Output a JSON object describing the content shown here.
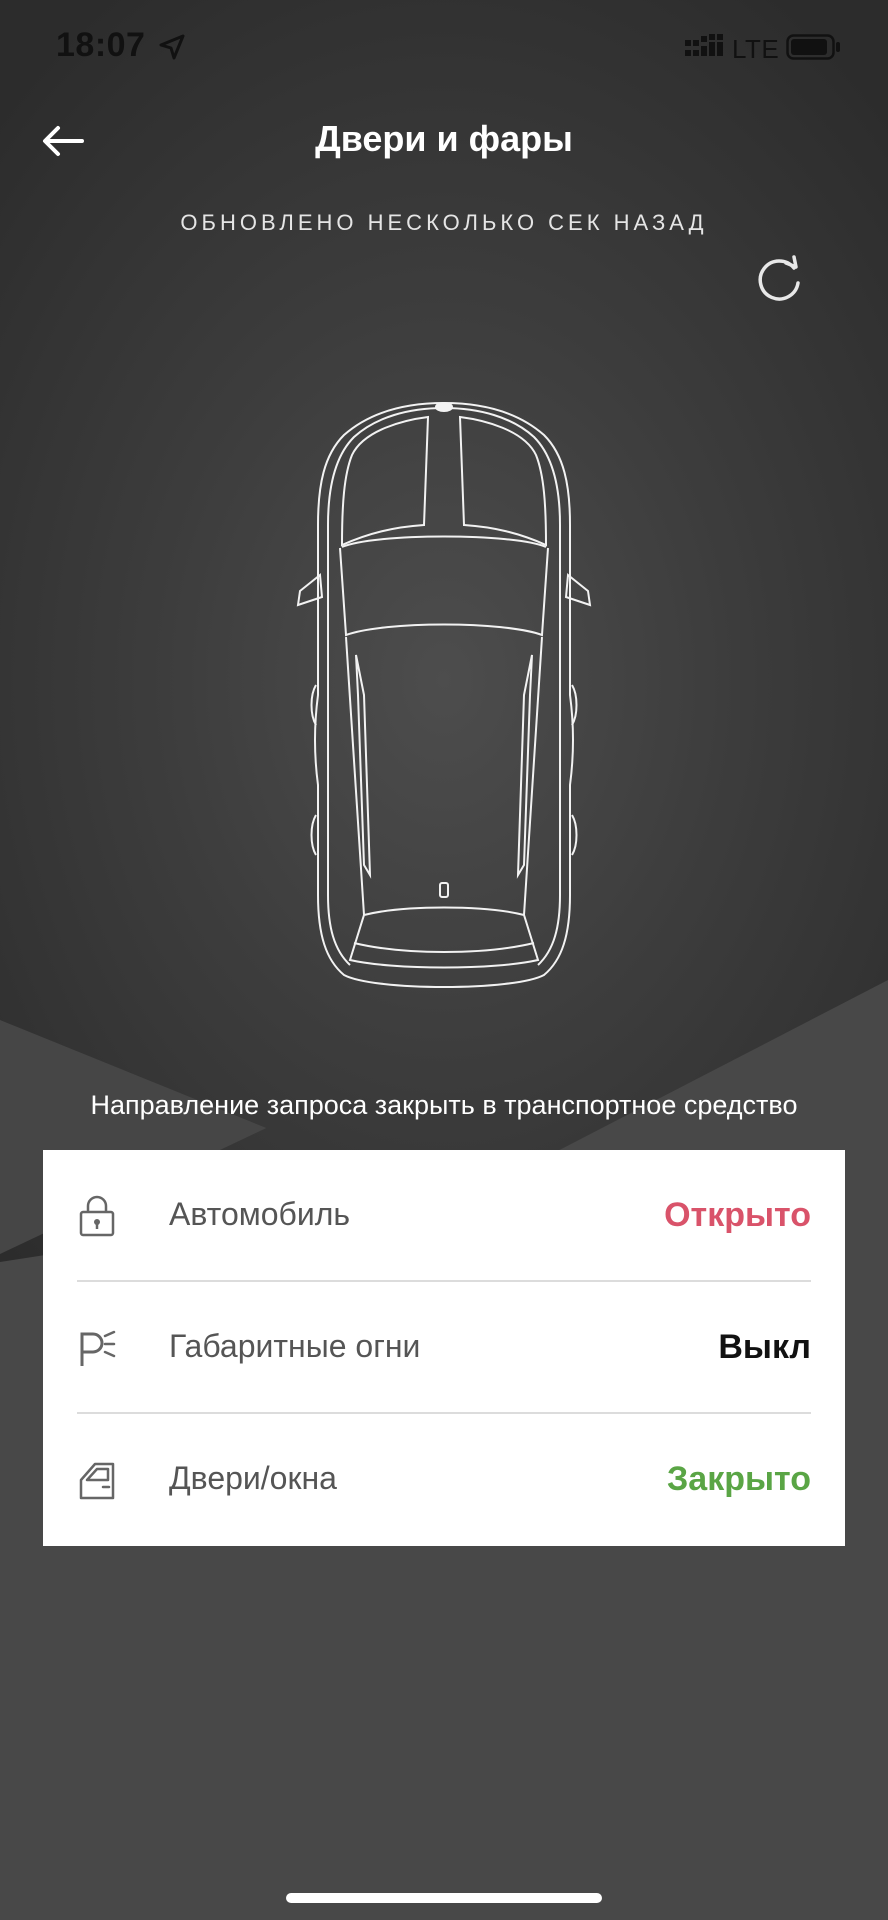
{
  "status_bar": {
    "time": "18:07",
    "network": "LTE"
  },
  "header": {
    "title": "Двери и фары",
    "updated": "ОБНОВЛЕНО НЕСКОЛЬКО СЕК НАЗАД"
  },
  "lock_request": "Направление запроса закрыть в транспортное средство",
  "status_items": [
    {
      "label": "Автомобиль",
      "value": "Открыто",
      "value_color": "#d9536a",
      "icon": "lock-icon"
    },
    {
      "label": "Габаритные огни",
      "value": "Выкл",
      "value_color": "#111111",
      "icon": "parking-lights-icon"
    },
    {
      "label": "Двери/окна",
      "value": "Закрыто",
      "value_color": "#5aa545",
      "icon": "car-door-icon"
    }
  ],
  "colors": {
    "background": "#3d3d3d",
    "open": "#d9536a",
    "closed": "#5aa545"
  }
}
